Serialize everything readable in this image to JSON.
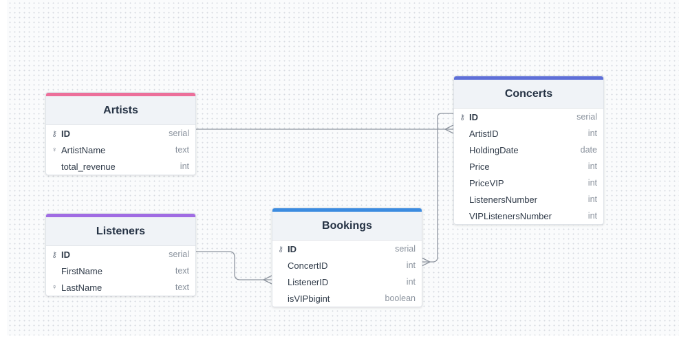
{
  "tables": {
    "artists": {
      "name": "Artists",
      "color": "#ec6f9a",
      "fields": [
        {
          "name": "ID",
          "type": "serial",
          "pk": true,
          "icon": "key-icon"
        },
        {
          "name": "ArtistName",
          "type": "text",
          "pk": false,
          "icon": "unique-icon"
        },
        {
          "name": "total_revenue",
          "type": "int",
          "pk": false,
          "icon": ""
        }
      ]
    },
    "listeners": {
      "name": "Listeners",
      "color": "#a06ce3",
      "fields": [
        {
          "name": "ID",
          "type": "serial",
          "pk": true,
          "icon": "key-icon"
        },
        {
          "name": "FirstName",
          "type": "text",
          "pk": false,
          "icon": ""
        },
        {
          "name": "LastName",
          "type": "text",
          "pk": false,
          "icon": "unique-icon"
        }
      ]
    },
    "bookings": {
      "name": "Bookings",
      "color": "#3b8be0",
      "fields": [
        {
          "name": "ID",
          "type": "serial",
          "pk": true,
          "icon": "key-icon"
        },
        {
          "name": "ConcertID",
          "type": "int",
          "pk": false,
          "icon": ""
        },
        {
          "name": "ListenerID",
          "type": "int",
          "pk": false,
          "icon": ""
        },
        {
          "name": "isVIPbigint",
          "type": "boolean",
          "pk": false,
          "icon": ""
        }
      ]
    },
    "concerts": {
      "name": "Concerts",
      "color": "#5e6fd8",
      "fields": [
        {
          "name": "ID",
          "type": "serial",
          "pk": true,
          "icon": "key-icon"
        },
        {
          "name": "ArtistID",
          "type": "int",
          "pk": false,
          "icon": ""
        },
        {
          "name": "HoldingDate",
          "type": "date",
          "pk": false,
          "icon": ""
        },
        {
          "name": "Price",
          "type": "int",
          "pk": false,
          "icon": ""
        },
        {
          "name": "PriceVIP",
          "type": "int",
          "pk": false,
          "icon": ""
        },
        {
          "name": "ListenersNumber",
          "type": "int",
          "pk": false,
          "icon": ""
        },
        {
          "name": "VIPListenersNumber",
          "type": "int",
          "pk": false,
          "icon": ""
        }
      ]
    }
  },
  "relations": [
    {
      "from": "Artists.ID",
      "to": "Concerts.ArtistID",
      "type": "one-to-many"
    },
    {
      "from": "Listeners.ID",
      "to": "Bookings.ListenerID",
      "type": "one-to-many"
    },
    {
      "from": "Concerts.ID",
      "to": "Bookings.ConcertID",
      "type": "one-to-many"
    }
  ]
}
